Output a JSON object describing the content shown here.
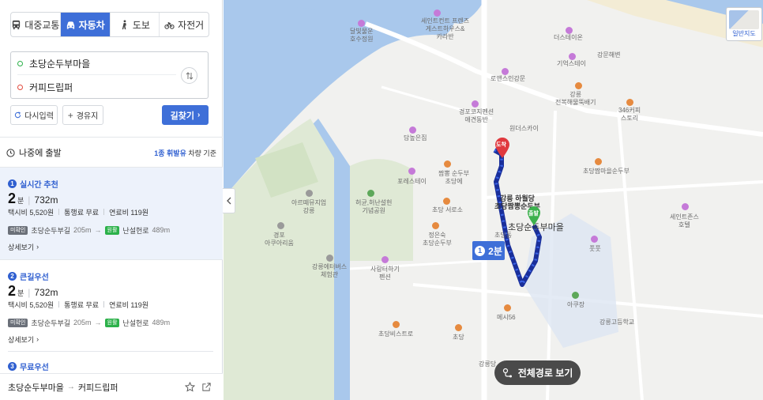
{
  "modes": [
    {
      "label": "대중교통",
      "icon": "bus-icon",
      "active": false
    },
    {
      "label": "자동차",
      "icon": "car-icon",
      "active": true
    },
    {
      "label": "도보",
      "icon": "walk-icon",
      "active": false
    },
    {
      "label": "자전거",
      "icon": "bicycle-icon",
      "active": false
    }
  ],
  "route": {
    "start": "초당순두부마을",
    "end": "커피드립퍼"
  },
  "actions": {
    "reset": "다시입력",
    "via": "경유지",
    "search": "길찾기"
  },
  "depart": {
    "label": "나중에 출발",
    "vehicle_highlight": "1종 휘발유",
    "vehicle_suffix": "차량 기준"
  },
  "results": [
    {
      "num": "1",
      "title": "실시간 추천",
      "time_value": "2",
      "time_unit": "분",
      "distance": "732m",
      "taxi": "택시비 5,520원",
      "toll": "통행료 무료",
      "fuel": "연료비 119원",
      "road1_tag": "미확인",
      "road1": "초당순두부길",
      "road1_len": "205m",
      "road2_tag": "원활",
      "road2": "난설헌로",
      "road2_len": "489m",
      "detail": "상세보기"
    },
    {
      "num": "2",
      "title": "큰길우선",
      "time_value": "2",
      "time_unit": "분",
      "distance": "732m",
      "taxi": "택시비 5,520원",
      "toll": "통행료 무료",
      "fuel": "연료비 119원",
      "road1_tag": "미확인",
      "road1": "초당순두부길",
      "road1_len": "205m",
      "road2_tag": "원활",
      "road2": "난설헌로",
      "road2_len": "489m",
      "detail": "상세보기"
    },
    {
      "num": "3",
      "title": "무료우선"
    }
  ],
  "bottom": {
    "start": "초당순두부마을",
    "arrow": "→",
    "end": "커피드립퍼"
  },
  "map": {
    "type_button": "일반지도",
    "route_badge_num": "1",
    "route_badge_time": "2분",
    "pin_end": "도착",
    "pin_start": "출발",
    "full_route_button": "전체경로 보기",
    "labels": [
      {
        "text": "세인트컨트 프렌즈\n게스트하우스&\n카라반"
      },
      {
        "text": "더스테이온"
      },
      {
        "text": "강문해변"
      },
      {
        "text": "기억스테이"
      },
      {
        "text": "로앤스인강문"
      },
      {
        "text": "달빛물운\n호수정원"
      },
      {
        "text": "강릉\n전복해물뚝배기"
      },
      {
        "text": "346커피\n스토리"
      },
      {
        "text": "경포코지펜션\n애견동반"
      },
      {
        "text": "원더스카이"
      },
      {
        "text": "담높은집"
      },
      {
        "text": "짬뽕 순두부\n초당에"
      },
      {
        "text": "포레스테이"
      },
      {
        "text": "초당짬마을순두부"
      },
      {
        "text": "강릉 하월당\n초당짬뽕순두부"
      },
      {
        "text": "아르떼뮤지엄\n강릉"
      },
      {
        "text": "허균,허난설헌\n기념공원"
      },
      {
        "text": "초당 서로소"
      },
      {
        "text": "초당순두부마을"
      },
      {
        "text": "초당동"
      },
      {
        "text": "세인트존스\n호텔"
      },
      {
        "text": "경포\n아쿠아리움"
      },
      {
        "text": "정은숙\n초당순두부"
      },
      {
        "text": "강릉에터버스\n체험관"
      },
      {
        "text": "사랑터하기\n펜션"
      },
      {
        "text": "풋풋"
      },
      {
        "text": "아쿠장"
      },
      {
        "text": "강릉고등학교"
      },
      {
        "text": "메시56"
      },
      {
        "text": "초당비스트로"
      },
      {
        "text": "초당"
      },
      {
        "text": "강릉당"
      }
    ]
  }
}
